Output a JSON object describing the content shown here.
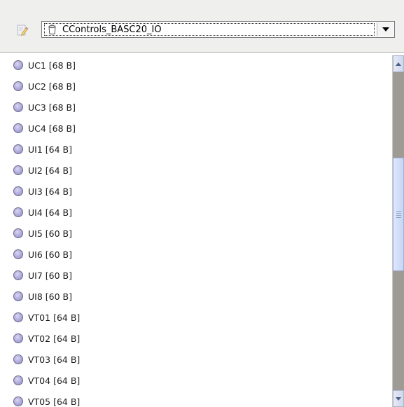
{
  "toolbar": {
    "edit_icon": "edit-pencil-icon",
    "combo": {
      "icon": "mug-icon",
      "selected_value": "CControls_BASC20_IO",
      "arrow_icon": "chevron-down-icon"
    }
  },
  "list": {
    "item_icon": "circle-bullet-icon",
    "items": [
      {
        "label": "UC1 [68 B]"
      },
      {
        "label": "UC2 [68 B]"
      },
      {
        "label": "UC3 [68 B]"
      },
      {
        "label": "UC4 [68 B]"
      },
      {
        "label": "UI1 [64 B]"
      },
      {
        "label": "UI2 [64 B]"
      },
      {
        "label": "UI3 [64 B]"
      },
      {
        "label": "UI4 [64 B]"
      },
      {
        "label": "UI5 [60 B]"
      },
      {
        "label": "UI6 [60 B]"
      },
      {
        "label": "UI7 [60 B]"
      },
      {
        "label": "UI8 [60 B]"
      },
      {
        "label": "VT01 [64 B]"
      },
      {
        "label": "VT02 [64 B]"
      },
      {
        "label": "VT03 [64 B]"
      },
      {
        "label": "VT04 [64 B]"
      },
      {
        "label": "VT05 [64 B]"
      }
    ]
  },
  "scrollbar": {
    "up_icon": "arrow-up-icon",
    "down_icon": "arrow-down-icon",
    "thumb_grip_icon": "grip-icon"
  },
  "colors": {
    "toolbar_bg": "#efefee",
    "scroll_track": "#9e9a94",
    "scroll_thumb": "#c6d5f7",
    "item_bullet": "#aeaadb"
  }
}
